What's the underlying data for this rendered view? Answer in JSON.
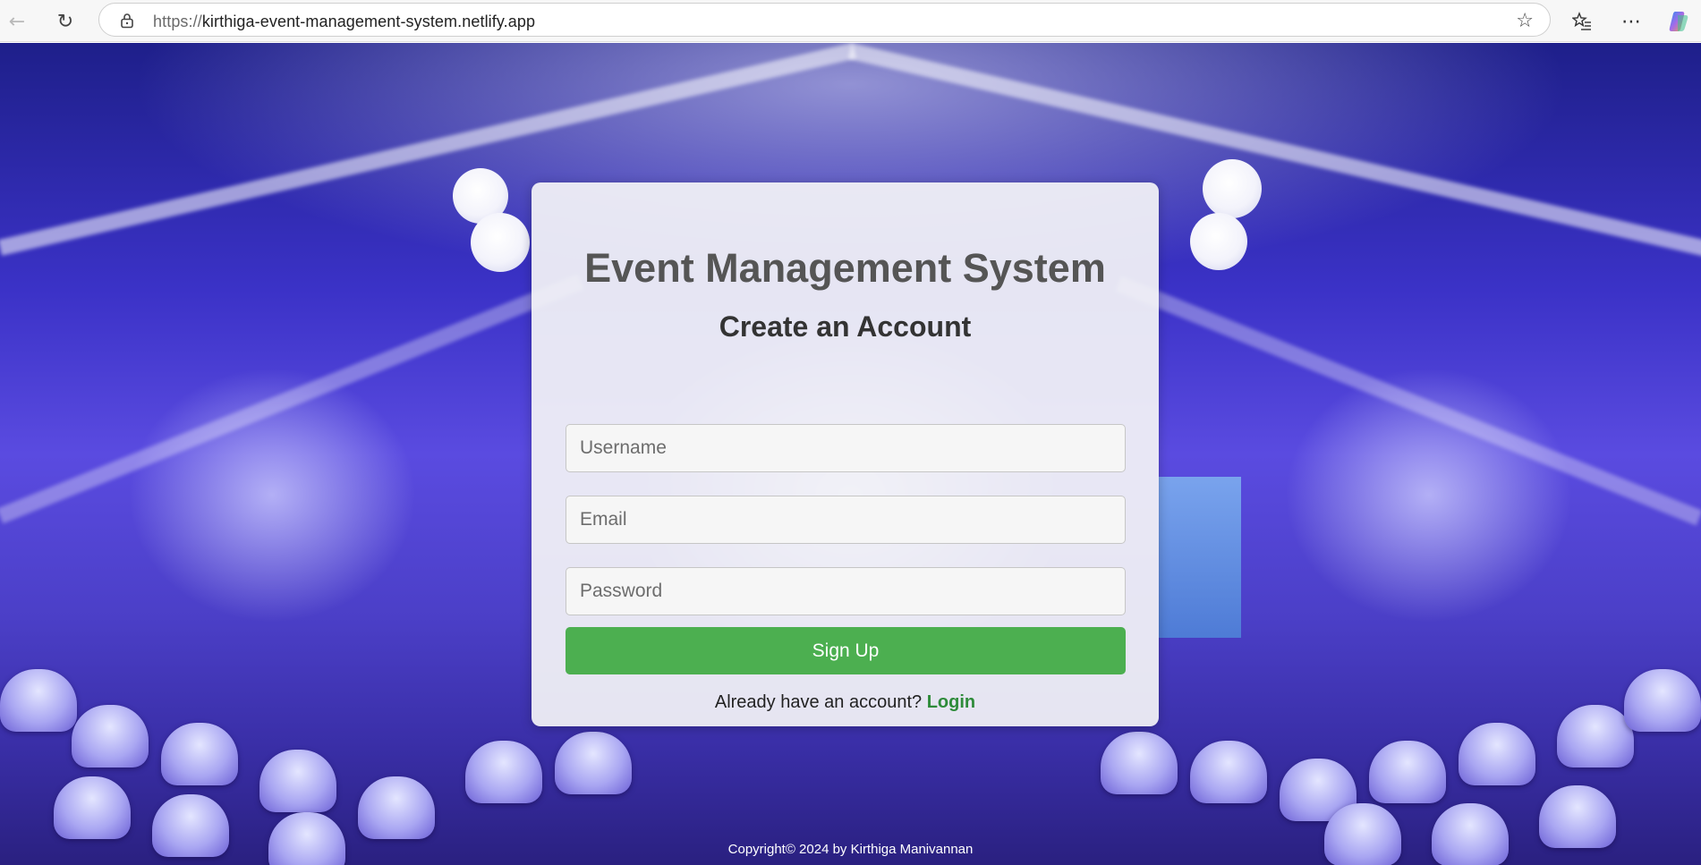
{
  "browser": {
    "url_scheme": "https://",
    "url_host": "kirthiga-event-management-system.netlify.app",
    "icons": [
      "back-icon",
      "refresh-icon",
      "lock-icon",
      "star-icon",
      "favorites-icon",
      "more-icon",
      "copilot-icon"
    ]
  },
  "card": {
    "title": "Event Management System",
    "subtitle": "Create an Account",
    "username_placeholder": "Username",
    "email_placeholder": "Email",
    "password_placeholder": "Password",
    "signup_label": "Sign Up",
    "already_text": "Already have an account? ",
    "login_label": "Login"
  },
  "footer": {
    "text": "Copyright© 2024 by Kirthiga Manivannan"
  },
  "colors": {
    "button": "#4caf50",
    "login_link": "#2e8b3a"
  }
}
